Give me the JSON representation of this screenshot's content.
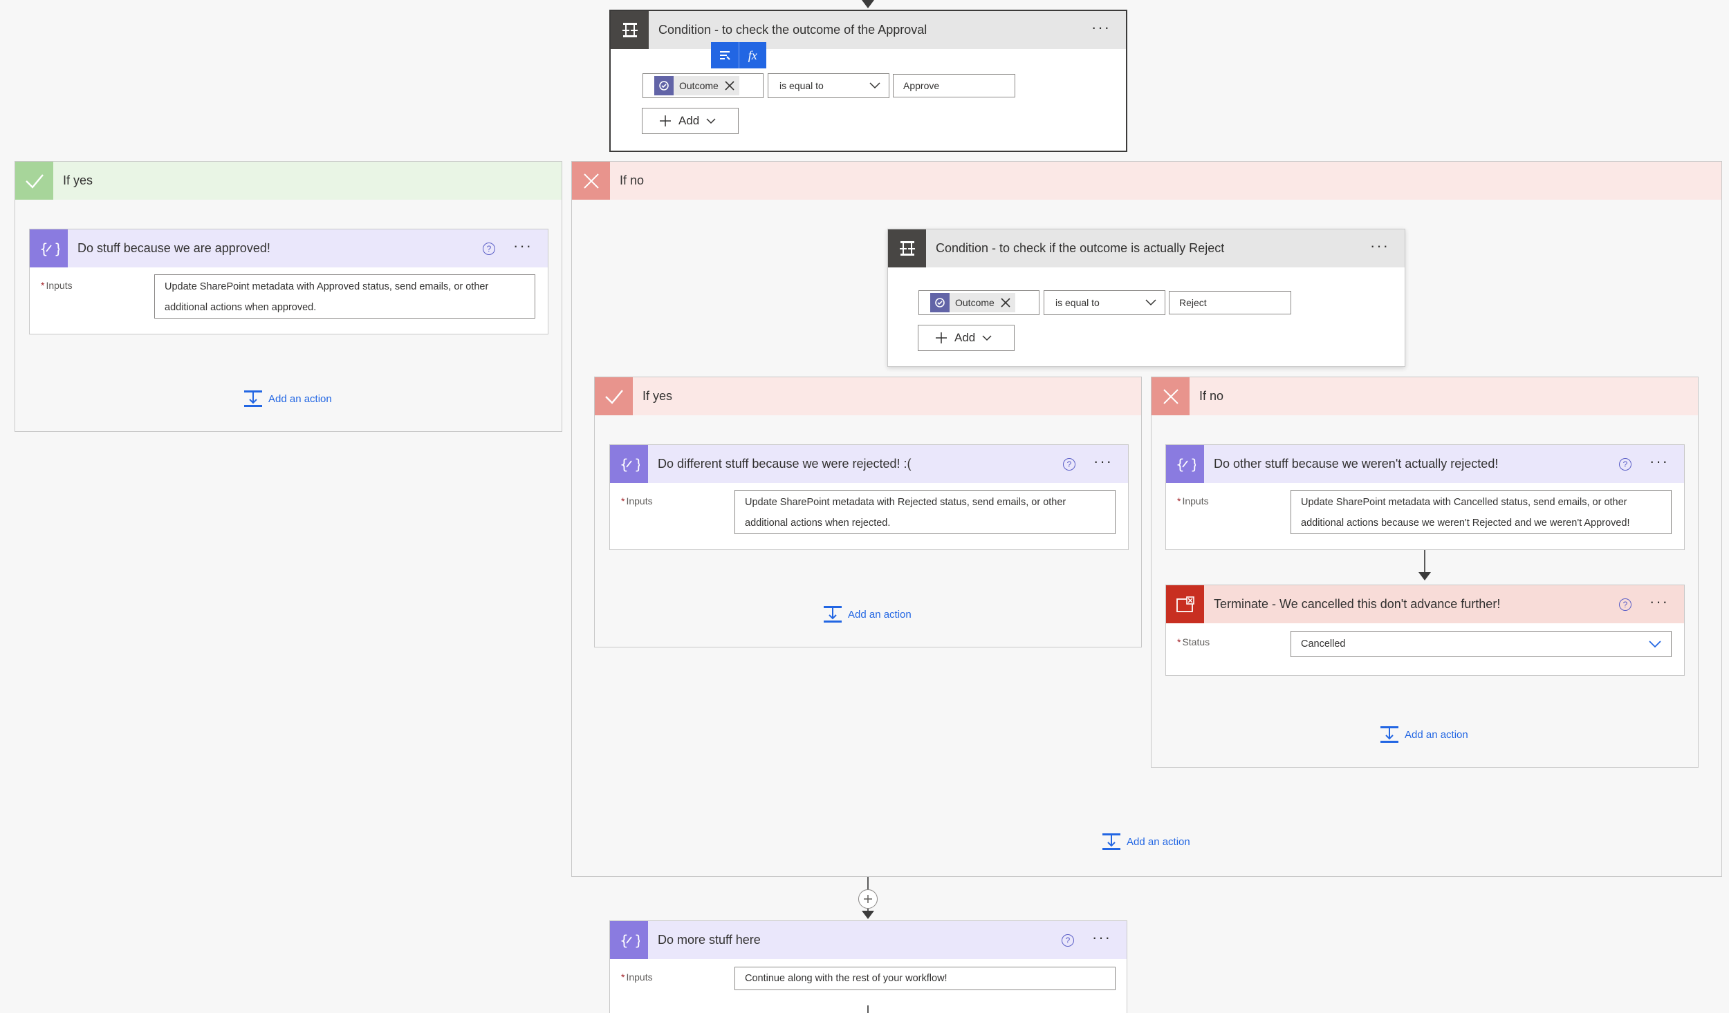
{
  "colors": {
    "accent": "#2266e3",
    "condition_tile": "#484644",
    "compose_tile": "#8a7be0",
    "compose_header": "#eae7fb",
    "terminate_tile": "#c82f21",
    "terminate_header": "#f8dcd8",
    "yes_tile": "#a7d59a",
    "no_tile": "#e8948d"
  },
  "condition_main": {
    "title": "Condition - to check the outcome of the Approval",
    "token": "Outcome",
    "operator": "is equal to",
    "value": "Approve",
    "add_label": "Add",
    "toolbar_fx": "fx"
  },
  "left_yes": {
    "label": "If yes",
    "action_title": "Do stuff because we are approved!",
    "inputs_label": "Inputs",
    "inputs_line1": "Update SharePoint metadata with Approved status, send emails, or other",
    "inputs_line2": "additional actions when approved.",
    "add_action": "Add an action"
  },
  "right_no": {
    "label": "If no",
    "add_action": "Add an action",
    "condition": {
      "title": "Condition - to check if the outcome is actually Reject",
      "token": "Outcome",
      "operator": "is equal to",
      "value": "Reject",
      "add_label": "Add"
    },
    "inner_yes": {
      "label": "If yes",
      "action_title": "Do different stuff because we were rejected! :(",
      "inputs_label": "Inputs",
      "inputs_line1": "Update SharePoint metadata with Rejected status, send emails, or other",
      "inputs_line2": "additional actions when rejected.",
      "add_action": "Add an action"
    },
    "inner_no": {
      "label": "If no",
      "action_title": "Do other stuff because we weren't actually rejected!",
      "inputs_label": "Inputs",
      "inputs_line1": "Update SharePoint metadata with Cancelled status, send emails, or other",
      "inputs_line2": "additional actions because we weren't Rejected and we weren't Approved!",
      "terminate_title": "Terminate - We cancelled this don't advance further!",
      "status_label": "Status",
      "status_value": "Cancelled",
      "add_action": "Add an action"
    }
  },
  "bottom": {
    "action_title": "Do more stuff here",
    "inputs_label": "Inputs",
    "inputs_value": "Continue along with the rest of your workflow!"
  }
}
